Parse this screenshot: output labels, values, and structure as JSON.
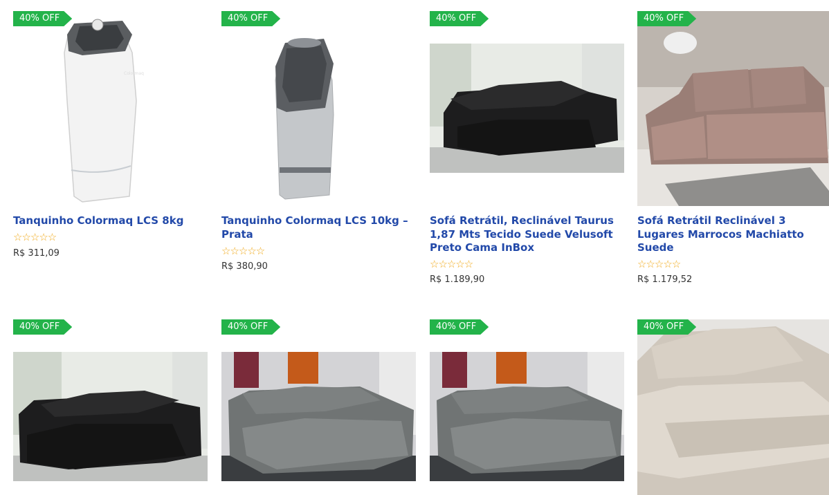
{
  "badge_color": "#23b34a",
  "title_color": "#2249a9",
  "star_color": "#f0a818",
  "products": [
    {
      "badge": "40% OFF",
      "title": "Tanquinho Colormaq LCS 8kg",
      "stars": "☆☆☆☆☆",
      "rating": 0,
      "price": "R$ 311,09",
      "brand": "Colormaq",
      "image": "white-washing-machine"
    },
    {
      "badge": "40% OFF",
      "title": "Tanquinho Colormaq LCS 10kg – Prata",
      "stars": "☆☆☆☆☆",
      "rating": 0,
      "price": "R$ 380,90",
      "brand": "Colormaq",
      "image": "silver-washing-machine"
    },
    {
      "badge": "40% OFF",
      "title": "Sofá Retrátil, Reclinável Taurus 1,87 Mts Tecido Suede Velusoft Preto Cama InBox",
      "stars": "☆☆☆☆☆",
      "rating": 0,
      "price": "R$ 1.189,90",
      "image": "black-sofa"
    },
    {
      "badge": "40% OFF",
      "title": "Sofá Retrátil Reclinável 3 Lugares Marrocos Machiatto Suede",
      "stars": "☆☆☆☆☆",
      "rating": 0,
      "price": "R$ 1.179,52",
      "image": "mauve-sofa"
    },
    {
      "badge": "40% OFF",
      "image": "black-sofa"
    },
    {
      "badge": "40% OFF",
      "image": "grey-sofa"
    },
    {
      "badge": "40% OFF",
      "image": "grey-sofa"
    },
    {
      "badge": "40% OFF",
      "image": "beige-sofa"
    }
  ]
}
